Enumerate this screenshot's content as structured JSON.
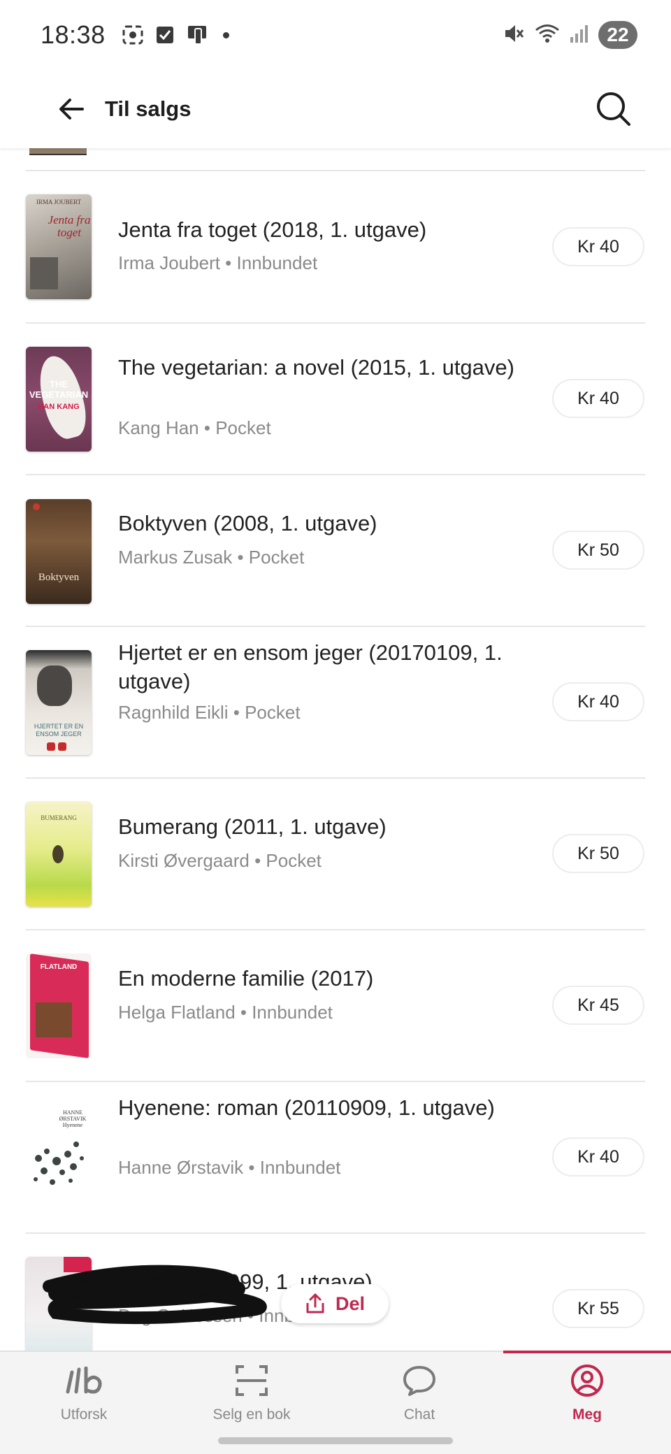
{
  "status_bar": {
    "time": "18:38",
    "battery": "22"
  },
  "app_bar": {
    "back_icon": "arrow-left-icon",
    "title": "Til salgs",
    "search_icon": "search-icon"
  },
  "books": [
    {
      "title": "Jenta fra toget (2018, 1. utgave)",
      "author": "Irma Joubert",
      "format": "Innbundet",
      "meta": "Irma Joubert • Innbundet",
      "price": "Kr 40",
      "cover_text": "Jenta fra toget"
    },
    {
      "title": "The vegetarian: a novel (2015, 1. utgave)",
      "author": "Kang Han",
      "format": "Pocket",
      "meta": "Kang Han • Pocket",
      "price": "Kr 40",
      "cover_text": "THE VEGETARIAN"
    },
    {
      "title": "Boktyven (2008, 1. utgave)",
      "author": "Markus Zusak",
      "format": "Pocket",
      "meta": "Markus Zusak • Pocket",
      "price": "Kr 50",
      "cover_text": "Boktyven"
    },
    {
      "title": "Hjertet er en ensom jeger (20170109, 1. utgave)",
      "author": "Ragnhild Eikli",
      "format": "Pocket",
      "meta": "Ragnhild Eikli • Pocket",
      "price": "Kr 40",
      "cover_text": "HJERTET ER EN ENSOM JEGER"
    },
    {
      "title": "Bumerang (2011, 1. utgave)",
      "author": "Kirsti Øvergaard",
      "format": "Pocket",
      "meta": "Kirsti Øvergaard • Pocket",
      "price": "Kr 50",
      "cover_text": "BUMERANG"
    },
    {
      "title": "En moderne familie  (2017)",
      "author": "Helga Flatland",
      "format": "Innbundet",
      "meta": "Helga Flatland • Innbundet",
      "price": "Kr 45",
      "cover_text": "FLATLAND"
    },
    {
      "title": "Hyenene: roman (20110909, 1. utgave)",
      "author": "Hanne Ørstavik",
      "format": "Innbundet",
      "meta": "Hanne Ørstavik • Innbundet",
      "price": "Kr 40",
      "cover_text": "HANNE ØRSTAVIK Hyenene"
    },
    {
      "title": "Egoisten (1999, 1. utgave)",
      "author": "Dag O. Hessen",
      "format": "Innbundet",
      "meta": "Dag O. Hessen • Innbundet",
      "price": "Kr 55",
      "cover_text": ""
    }
  ],
  "share_button": {
    "label": "Del",
    "icon": "share-icon"
  },
  "bottom_nav": {
    "items": [
      {
        "label": "Utforsk",
        "icon": "lb-logo-icon",
        "active": false
      },
      {
        "label": "Selg en bok",
        "icon": "scan-icon",
        "active": false
      },
      {
        "label": "Chat",
        "icon": "chat-bubble-icon",
        "active": false
      },
      {
        "label": "Meg",
        "icon": "profile-icon",
        "active": true
      }
    ]
  },
  "colors": {
    "accent": "#c0284f",
    "divider": "#e6e6e6",
    "meta_text": "#8a8a8a",
    "nav_background": "#f4f4f4"
  }
}
